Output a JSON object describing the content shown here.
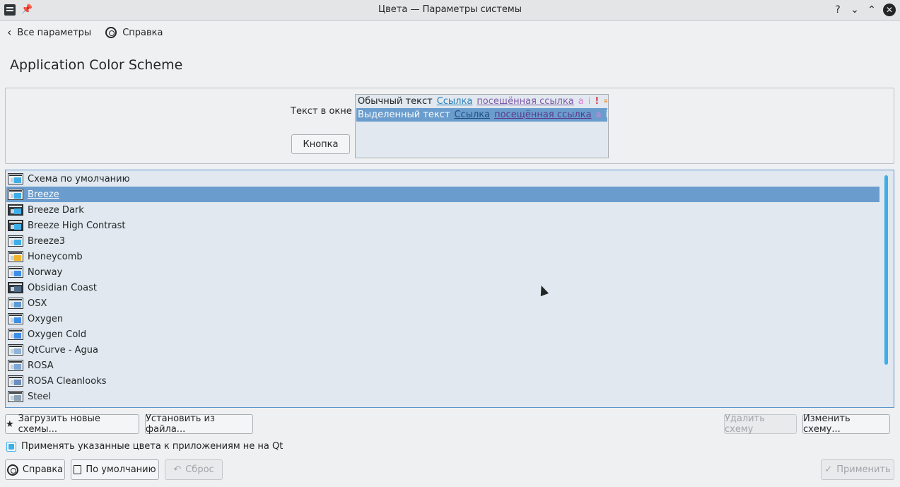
{
  "window": {
    "title": "Цвета — Параметры системы",
    "help_glyph": "?",
    "minimize_glyph": "⌄",
    "maximize_glyph": "⌃",
    "close_glyph": "✕"
  },
  "nav": {
    "back_label": "Все параметры",
    "help_label": "Справка"
  },
  "page_title": "Application Color Scheme",
  "preview": {
    "window_text_label": "Текст в окне",
    "button_label": "Кнопка",
    "normal_text": "Обычный текст",
    "selected_text": "Выделенный текст",
    "link": "Ссылка",
    "visited_link": "посещённая ссылка",
    "glyph_a": "a",
    "glyph_i": "i",
    "glyph_ex": "!",
    "glyph_eq": "=",
    "glyph_plus": "+"
  },
  "schemes": [
    {
      "label": "Схема по умолчанию",
      "accent": "#3daee9",
      "dark": false
    },
    {
      "label": "Breeze",
      "accent": "#3daee9",
      "dark": false,
      "selected": true
    },
    {
      "label": "Breeze Dark",
      "accent": "#3daee9",
      "dark": true
    },
    {
      "label": "Breeze High Contrast",
      "accent": "#3daee9",
      "dark": true
    },
    {
      "label": "Breeze3",
      "accent": "#3daee9",
      "dark": false
    },
    {
      "label": "Honeycomb",
      "accent": "#f0b429",
      "dark": false
    },
    {
      "label": "Norway",
      "accent": "#3d8ee9",
      "dark": false
    },
    {
      "label": "Obsidian Coast",
      "accent": "#4d6b8a",
      "dark": true
    },
    {
      "label": "OSX",
      "accent": "#5b9bd5",
      "dark": false
    },
    {
      "label": "Oxygen",
      "accent": "#3d8ee9",
      "dark": false
    },
    {
      "label": "Oxygen Cold",
      "accent": "#3d8ee9",
      "dark": false
    },
    {
      "label": "QtCurve - Agua",
      "accent": "#8fb3d9",
      "dark": false
    },
    {
      "label": "ROSA",
      "accent": "#7da7d6",
      "dark": false
    },
    {
      "label": "ROSA Cleanlooks",
      "accent": "#6b8fbf",
      "dark": false
    },
    {
      "label": "Steel",
      "accent": "#8aa1b8",
      "dark": false
    }
  ],
  "buttons": {
    "load": "Загрузить новые схемы...",
    "install": "Установить из файла...",
    "delete": "Удалить схему",
    "edit": "Изменить схему...",
    "help": "Справка",
    "defaults": "По умолчанию",
    "reset": "Сброс",
    "apply": "Применить"
  },
  "checkbox": {
    "label": "Применять указанные цвета к приложениям не на Qt",
    "checked": true
  },
  "colors": {
    "accent": "#3daee9",
    "selection": "#6a9dcd"
  }
}
